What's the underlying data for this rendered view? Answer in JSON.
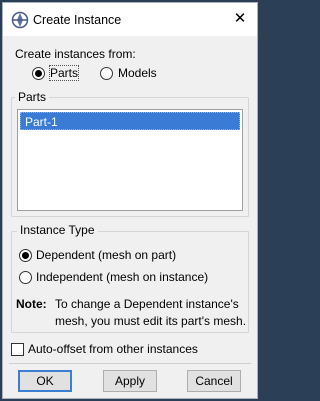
{
  "window": {
    "title": "Create Instance",
    "close_glyph": "✕"
  },
  "create_from": {
    "label": "Create instances from:",
    "options": [
      {
        "label": "Parts",
        "checked": true
      },
      {
        "label": "Models",
        "checked": false
      }
    ]
  },
  "parts": {
    "title": "Parts",
    "items": [
      "Part-1"
    ],
    "selected": "Part-1"
  },
  "instance_type": {
    "title": "Instance Type",
    "options": [
      {
        "label": "Dependent (mesh on part)",
        "checked": true
      },
      {
        "label": "Independent (mesh on instance)",
        "checked": false
      }
    ],
    "note_label": "Note:",
    "note_line1": "To change a Dependent instance's",
    "note_line2": "mesh, you must edit its part's mesh."
  },
  "auto_offset": {
    "label": "Auto-offset from other instances",
    "checked": false
  },
  "buttons": {
    "ok": "OK",
    "apply": "Apply",
    "cancel": "Cancel"
  },
  "colors": {
    "selection": "#3a7bd5",
    "default_button_border": "#3c7fd1",
    "background_desktop": "#2b3f57"
  }
}
